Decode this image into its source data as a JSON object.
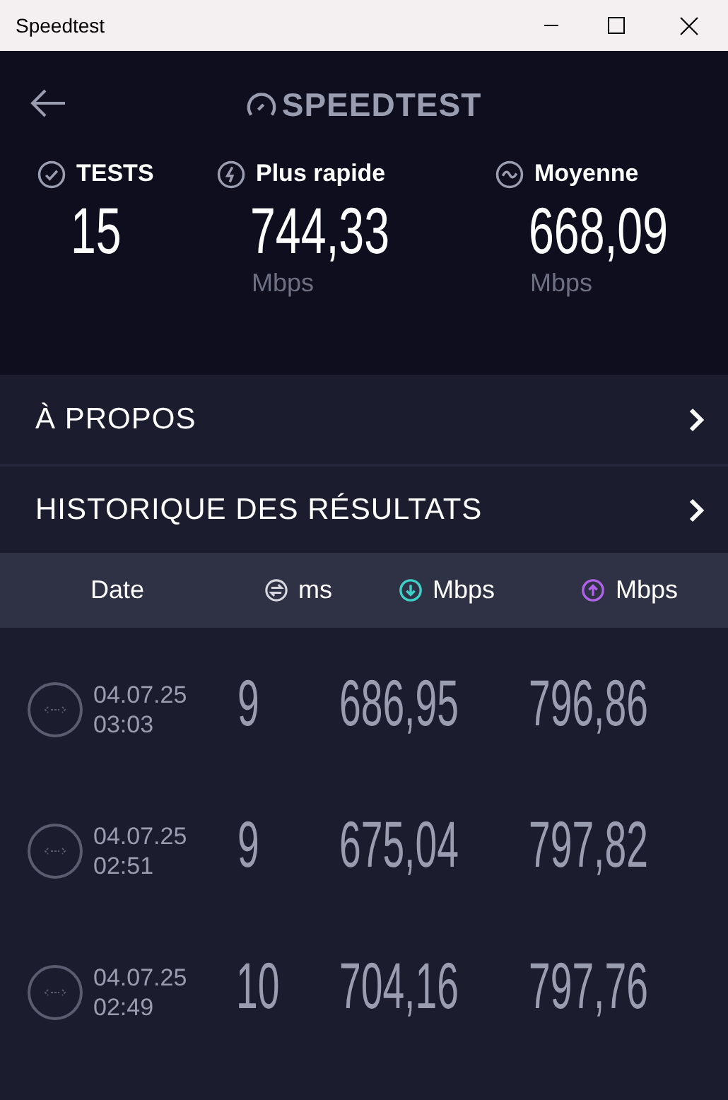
{
  "window": {
    "title": "Speedtest"
  },
  "header": {
    "logo": "SPEEDTEST"
  },
  "stats": [
    {
      "kind": "tests",
      "label": "TESTS",
      "value": "15"
    },
    {
      "kind": "fastest",
      "label": "Plus rapide",
      "value": "744,33",
      "unit": "Mbps"
    },
    {
      "kind": "average",
      "label": "Moyenne",
      "value": "668,09",
      "unit": "Mbps"
    }
  ],
  "menu": [
    {
      "label": "À PROPOS"
    },
    {
      "label": "HISTORIQUE DES RÉSULTATS"
    }
  ],
  "table": {
    "columns": [
      {
        "kind": "date",
        "label": "Date"
      },
      {
        "kind": "ping",
        "label": "ms"
      },
      {
        "kind": "download",
        "label": "Mbps"
      },
      {
        "kind": "upload",
        "label": "Mbps"
      }
    ],
    "rows": [
      {
        "date": "04.07.25",
        "time": "03:03",
        "ping": "9",
        "download": "686,95",
        "upload": "796,86"
      },
      {
        "date": "04.07.25",
        "time": "02:51",
        "ping": "9",
        "download": "675,04",
        "upload": "797,82"
      },
      {
        "date": "04.07.25",
        "time": "02:49",
        "ping": "10",
        "download": "704,16",
        "upload": "797,76"
      }
    ]
  }
}
